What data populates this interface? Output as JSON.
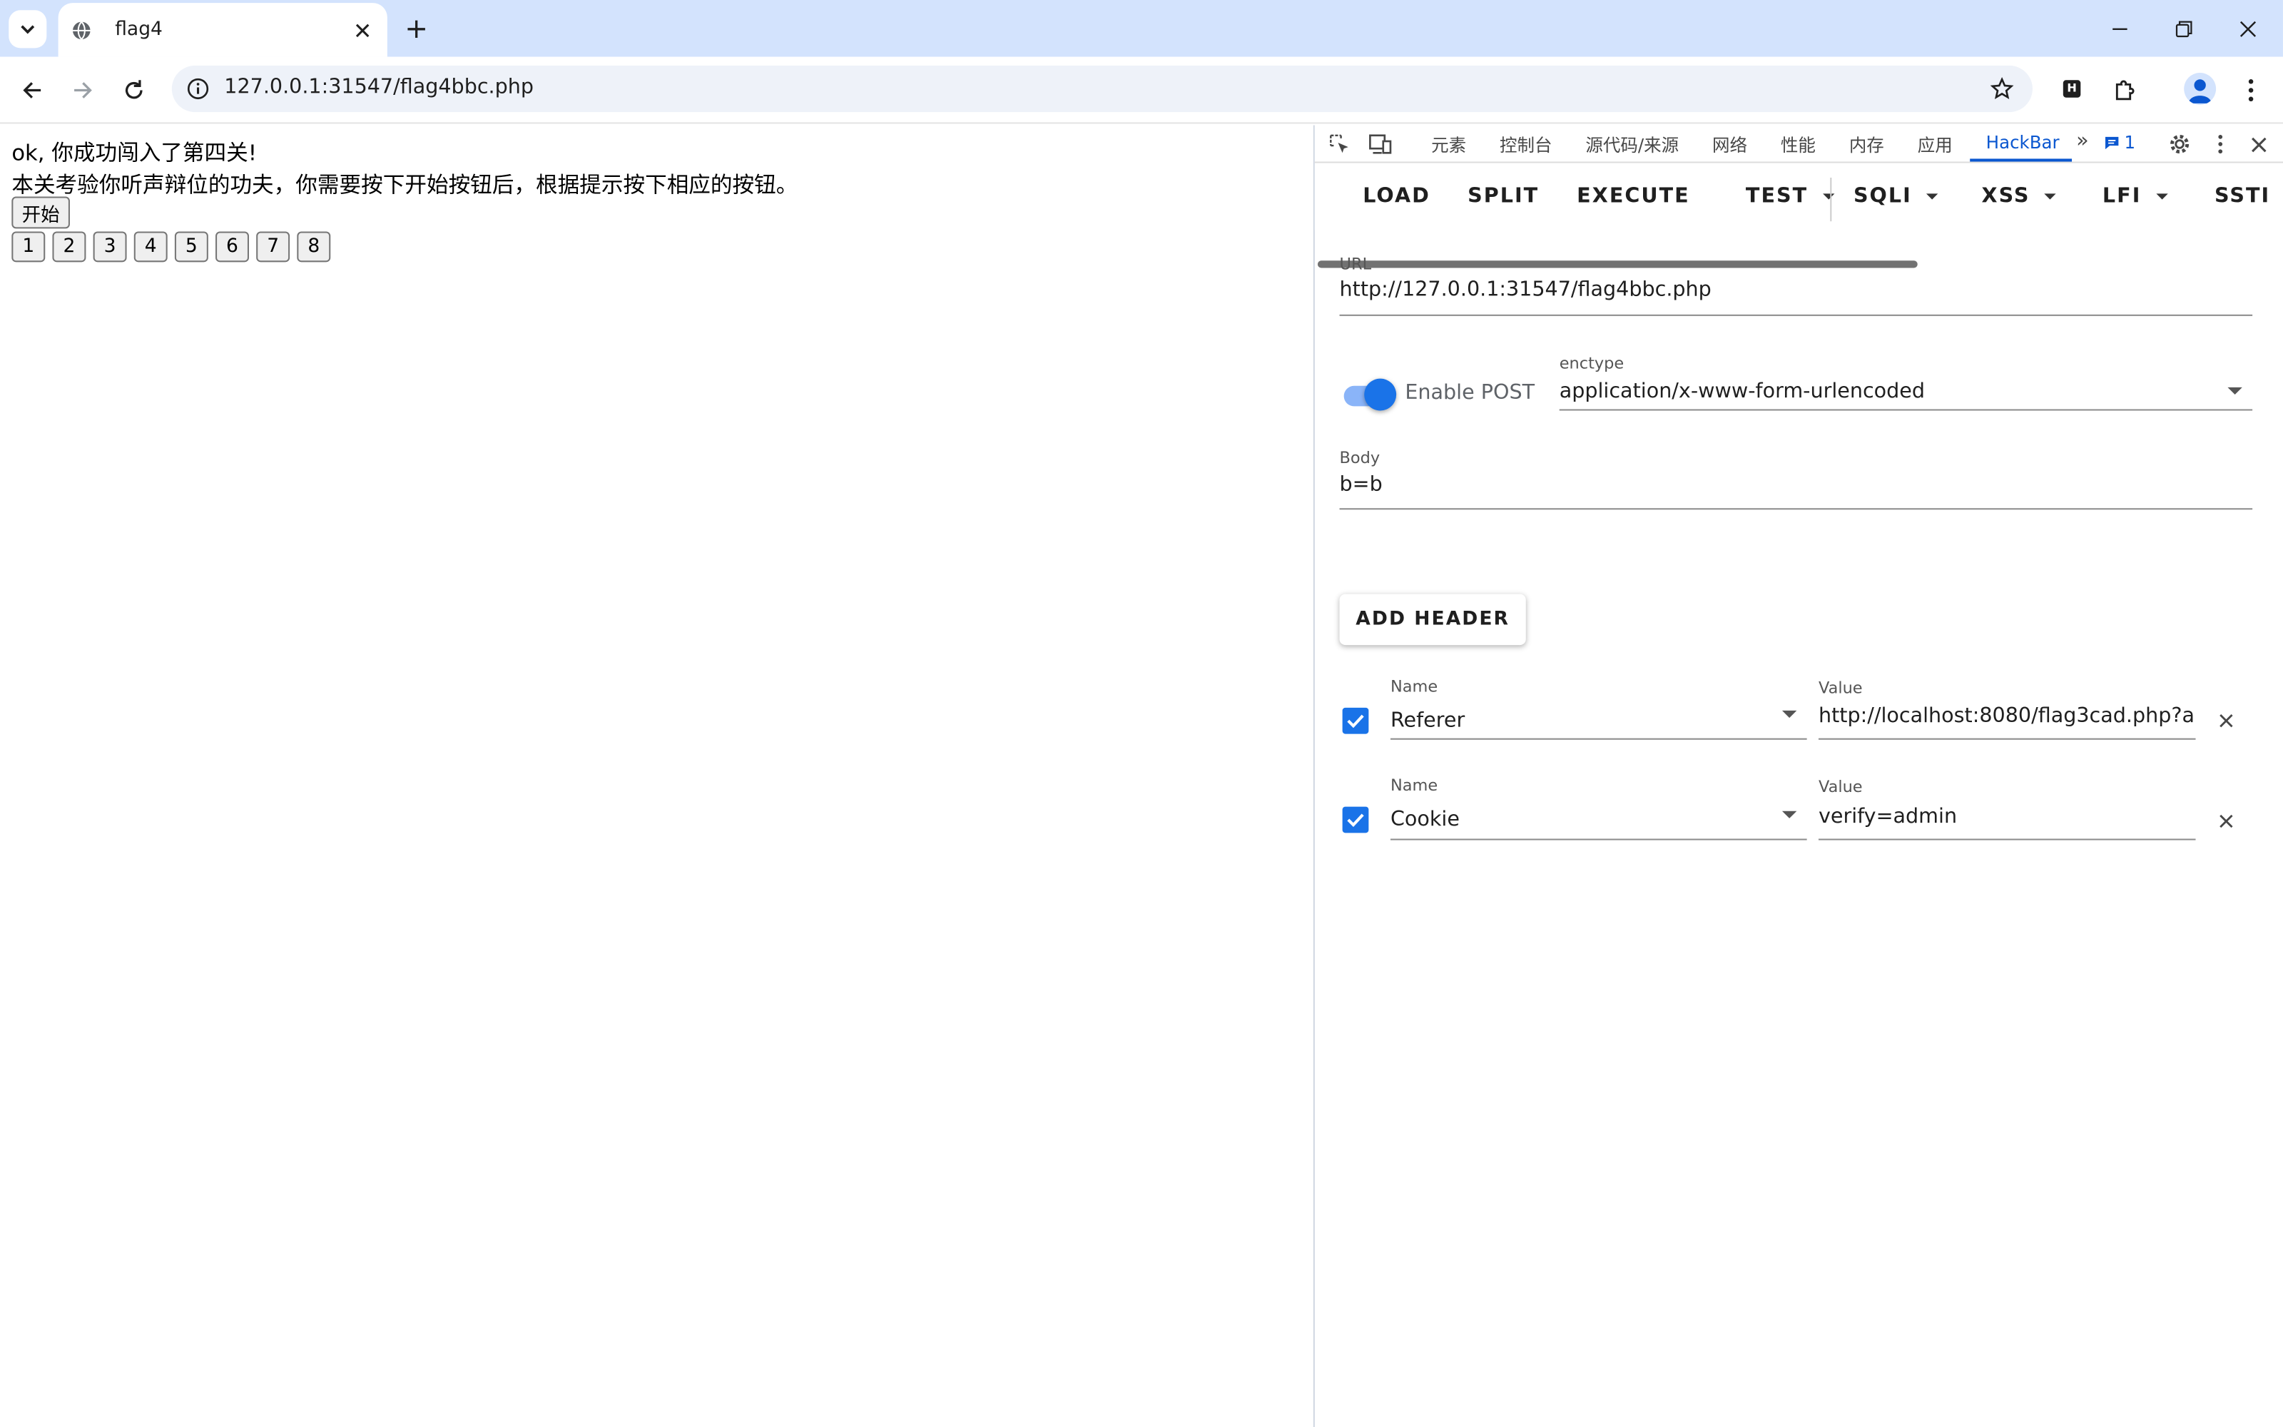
{
  "browser": {
    "tab_title": "flag4",
    "address": "127.0.0.1:31547/flag4bbc.php"
  },
  "page": {
    "line1": "ok, 你成功闯入了第四关!",
    "line2": "本关考验你听声辩位的功夫，你需要按下开始按钮后，根据提示按下相应的按钮。",
    "start_button": "开始",
    "number_buttons": [
      "1",
      "2",
      "3",
      "4",
      "5",
      "6",
      "7",
      "8"
    ]
  },
  "devtools": {
    "tabs": [
      "元素",
      "控制台",
      "源代码/来源",
      "网络",
      "性能",
      "内存",
      "应用",
      "HackBar"
    ],
    "active_tab": "HackBar",
    "more": "»",
    "issues_count": "1"
  },
  "hackbar": {
    "buttons": {
      "load": "LOAD",
      "split": "SPLIT",
      "execute": "EXECUTE",
      "test": "TEST",
      "sqli": "SQLI",
      "xss": "XSS",
      "lfi": "LFI",
      "ssti": "SSTI"
    },
    "url_label": "URL",
    "url_value": "http://127.0.0.1:31547/flag4bbc.php",
    "enable_post_label": "Enable POST",
    "enable_post_on": true,
    "enctype_label": "enctype",
    "enctype_value": "application/x-www-form-urlencoded",
    "body_label": "Body",
    "body_value": "b=b",
    "add_header": "ADD HEADER",
    "headers": [
      {
        "name_label": "Name",
        "name": "Referer",
        "value_label": "Value",
        "value": "http://localhost:8080/flag3cad.php?a",
        "checked": true
      },
      {
        "name_label": "Name",
        "name": "Cookie",
        "value_label": "Value",
        "value": "verify=admin",
        "checked": true
      }
    ]
  },
  "colors": {
    "tabstrip": "#d3e3fd",
    "accent": "#1a73e8",
    "active_tab_text": "#0b57d0"
  }
}
